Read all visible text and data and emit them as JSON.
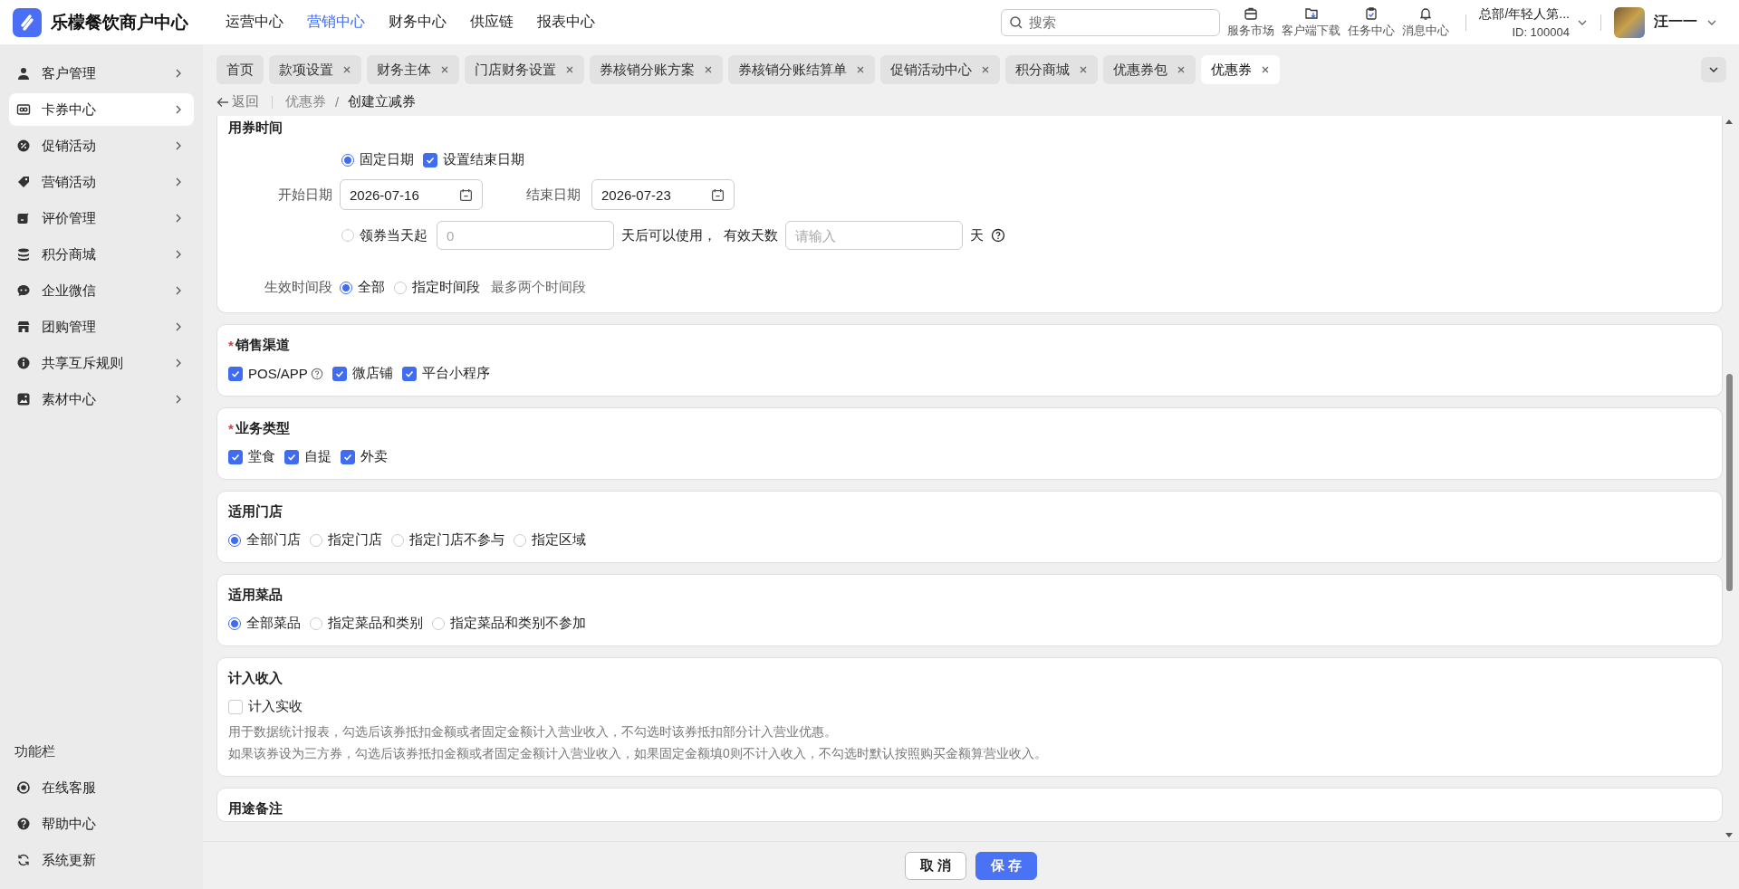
{
  "header": {
    "brand": "乐檬餐饮商户中心",
    "nav": [
      {
        "label": "运营中心",
        "selected": false
      },
      {
        "label": "营销中心",
        "selected": true
      },
      {
        "label": "财务中心",
        "selected": false
      },
      {
        "label": "供应链",
        "selected": false
      },
      {
        "label": "报表中心",
        "selected": false
      }
    ],
    "search": {
      "placeholder": "搜索"
    },
    "tools": [
      "服务市场",
      "客户端下载",
      "任务中心",
      "消息中心"
    ],
    "account": {
      "org": "总部/年轻人第...",
      "id": "ID: 100004"
    },
    "user": "汪一一"
  },
  "sidebar": {
    "items": [
      {
        "label": "客户管理",
        "selected": false
      },
      {
        "label": "卡券中心",
        "selected": true
      },
      {
        "label": "促销活动",
        "selected": false
      },
      {
        "label": "营销活动",
        "selected": false
      },
      {
        "label": "评价管理",
        "selected": false
      },
      {
        "label": "积分商城",
        "selected": false
      },
      {
        "label": "企业微信",
        "selected": false
      },
      {
        "label": "团购管理",
        "selected": false
      },
      {
        "label": "共享互斥规则",
        "selected": false
      },
      {
        "label": "素材中心",
        "selected": false
      }
    ],
    "footer_title": "功能栏",
    "footer_items": [
      "在线客服",
      "帮助中心",
      "系统更新"
    ]
  },
  "tabs": [
    {
      "label": "首页",
      "selected": false,
      "closable": false
    },
    {
      "label": "款项设置",
      "selected": false,
      "closable": true
    },
    {
      "label": "财务主体",
      "selected": false,
      "closable": true
    },
    {
      "label": "门店财务设置",
      "selected": false,
      "closable": true
    },
    {
      "label": "券核销分账方案",
      "selected": false,
      "closable": true
    },
    {
      "label": "券核销分账结算单",
      "selected": false,
      "closable": true
    },
    {
      "label": "促销活动中心",
      "selected": false,
      "closable": true
    },
    {
      "label": "积分商城",
      "selected": false,
      "closable": true
    },
    {
      "label": "优惠券包",
      "selected": false,
      "closable": true
    },
    {
      "label": "优惠券",
      "selected": true,
      "closable": true
    }
  ],
  "breadcrumb": {
    "back": "返回",
    "parent": "优惠券",
    "separator": "/",
    "current": "创建立减券"
  },
  "usage_time": {
    "title": "用券时间",
    "fixed": {
      "label": "固定日期",
      "selected": true
    },
    "set_end": {
      "label": "设置结束日期",
      "checked": true
    },
    "start_label": "开始日期",
    "start_value": "2026-07-16",
    "end_label": "结束日期",
    "end_value": "2026-07-23",
    "relative": {
      "label": "领券当天起",
      "selected": false,
      "placeholder": "0",
      "after": "天后可以使用，",
      "valid_label": "有效天数",
      "valid_placeholder": "请输入",
      "unit": "天"
    },
    "period_label": "生效时间段",
    "period_options": [
      {
        "label": "全部",
        "selected": true
      },
      {
        "label": "指定时间段",
        "selected": false
      }
    ],
    "period_hint": "最多两个时间段"
  },
  "sections": [
    {
      "kind": "checkboxes",
      "title": "销售渠道",
      "required_mark": "*",
      "options": [
        {
          "label": "POS/APP",
          "checked": true,
          "help": true
        },
        {
          "label": "微店铺",
          "checked": true,
          "help": false
        },
        {
          "label": "平台小程序",
          "checked": true,
          "help": false
        }
      ]
    },
    {
      "kind": "checkboxes",
      "title": "业务类型",
      "required_mark": "*",
      "options": [
        {
          "label": "堂食",
          "checked": true,
          "help": false
        },
        {
          "label": "自提",
          "checked": true,
          "help": false
        },
        {
          "label": "外卖",
          "checked": true,
          "help": false
        }
      ]
    },
    {
      "kind": "radios",
      "title": "适用门店",
      "options": [
        {
          "label": "全部门店",
          "selected": true
        },
        {
          "label": "指定门店",
          "selected": false
        },
        {
          "label": "指定门店不参与",
          "selected": false
        },
        {
          "label": "指定区域",
          "selected": false
        }
      ]
    },
    {
      "kind": "radios",
      "title": "适用菜品",
      "options": [
        {
          "label": "全部菜品",
          "selected": true
        },
        {
          "label": "指定菜品和类别",
          "selected": false
        },
        {
          "label": "指定菜品和类别不参加",
          "selected": false
        }
      ]
    },
    {
      "kind": "checkboxes",
      "title": "计入收入",
      "options": [
        {
          "label": "计入实收",
          "checked": false,
          "help": false
        }
      ],
      "notes": [
        "用于数据统计报表，勾选后该券抵扣金额或者固定金额计入营业收入，不勾选时该券抵扣部分计入营业优惠。",
        "如果该券设为三方券，勾选后该券抵扣金额或者固定金额计入营业收入，如果固定金额填0则不计入收入，不勾选时默认按照购买金额算营业收入。"
      ]
    },
    {
      "kind": "title_only",
      "title": "用途备注"
    }
  ],
  "footer": {
    "cancel": "取 消",
    "save": "保 存"
  }
}
